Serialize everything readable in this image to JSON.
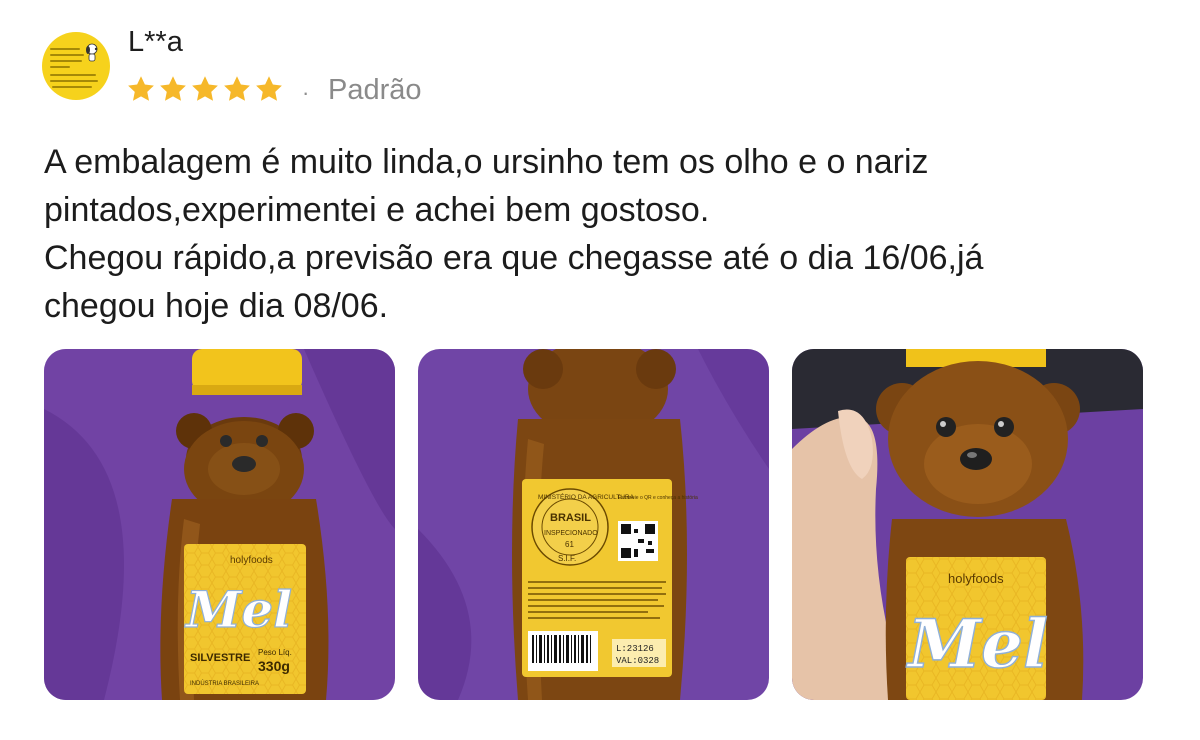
{
  "review": {
    "user": {
      "name": "L**a",
      "avatar_icon": "snoopy-sticker-avatar",
      "avatar_color": "#f6d21c"
    },
    "rating": {
      "stars": 5,
      "max": 5,
      "star_color": "#f6b82a",
      "star_icon": "star-icon"
    },
    "separator": "·",
    "variant": "Padrão",
    "text": "A embalagem é muito linda,o ursinho tem os olho e o nariz\npintados,experimentei e achei bem gostoso.\nChegou rápido,a previsão era que chegasse até o dia 16/06,já\nchegou hoje dia 08/06."
  },
  "photos": [
    {
      "brand": "holyfoods",
      "product": "Mel",
      "variety": "SILVESTRE",
      "weight_label": "Peso Líq.",
      "weight": "330g",
      "origin": "INDÚSTRIA BRASILEIRA"
    },
    {
      "seal_top": "MINISTÉRIO DA AGRICULTURA",
      "seal_country": "BRASIL",
      "seal_status": "INSPECIONADO",
      "seal_number": "61",
      "seal_bottom": "S.I.F.",
      "qr_note": "Escaneie o QR e conheça a história",
      "lot": "L:23126",
      "validity": "VAL:0328"
    },
    {
      "brand": "holyfoods",
      "product": "Mel"
    }
  ]
}
